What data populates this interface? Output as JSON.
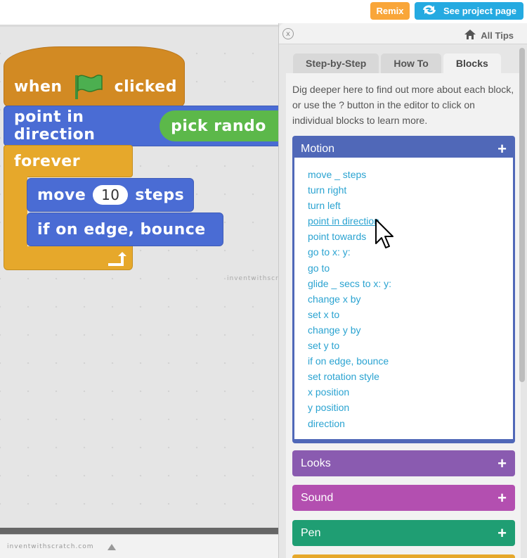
{
  "topbar": {
    "remix_label": "Remix",
    "project_label": "See project page"
  },
  "script": {
    "hat_when": "when",
    "hat_clicked": "clicked",
    "point_label": "point in direction",
    "pick_label": "pick rando",
    "forever_label": "forever",
    "move_label": "move",
    "move_value": "10",
    "steps_label": "steps",
    "bounce_label": "if on edge, bounce"
  },
  "watermark": "inventwithscratch.com",
  "tips": {
    "close_label": "x",
    "all_tips_label": "All Tips",
    "tabs": [
      {
        "label": "Step-by-Step"
      },
      {
        "label": "How To"
      },
      {
        "label": "Blocks"
      }
    ],
    "intro": "Dig deeper here to find out more about each block, or use the ? button in the editor to click on individual blocks to learn more.",
    "categories": [
      {
        "label": "Motion",
        "color": "#5068b8"
      },
      {
        "label": "Looks",
        "color": "#8a5bb0"
      },
      {
        "label": "Sound",
        "color": "#b34fb0"
      },
      {
        "label": "Pen",
        "color": "#1f9e73"
      }
    ],
    "plus_symbol": "+",
    "motion_items": [
      "move _ steps",
      "turn right",
      "turn left",
      "point in direction",
      "point towards",
      "go to x: y:",
      "go to",
      "glide _ secs to x: y:",
      "change x by",
      "set x to",
      "change y by",
      "set y to",
      "if on edge, bounce",
      "set rotation style",
      "x position",
      "y position",
      "direction"
    ]
  },
  "colors": {
    "motion": "#4a6cd4",
    "control": "#e6a82b",
    "events": "#d28a23",
    "operators": "#5cb84a",
    "link": "#2aa3d1"
  }
}
